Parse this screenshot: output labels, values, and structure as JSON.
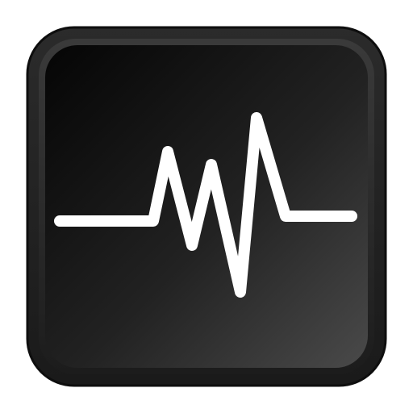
{
  "icon": {
    "name": "waveform-icon",
    "colors": {
      "frame_outer": "#1a1a1a",
      "frame_inner": "#2b2b2b",
      "face_dark": "#050505",
      "face_light": "#4a4a4a",
      "waveform": "#ffffff"
    }
  }
}
